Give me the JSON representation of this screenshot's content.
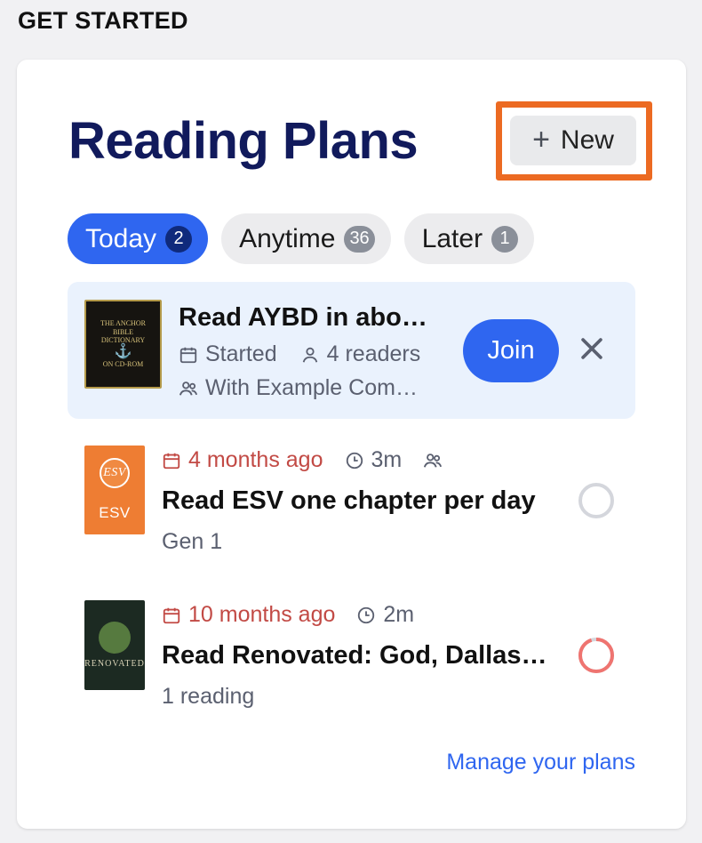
{
  "section_label": "GET STARTED",
  "card": {
    "title": "Reading Plans",
    "new_button": {
      "label": "New",
      "icon": "plus-icon"
    },
    "tabs": [
      {
        "label": "Today",
        "count": "2",
        "active": true
      },
      {
        "label": "Anytime",
        "count": "36",
        "active": false
      },
      {
        "label": "Later",
        "count": "1",
        "active": false
      }
    ],
    "invite": {
      "cover_text": "THE ANCHOR BIBLE DICTIONARY ON CD-ROM",
      "title": "Read AYBD in abo…",
      "status": "Started",
      "readers": "4 readers",
      "community": "With Example Com…",
      "join_label": "Join",
      "icons": [
        "calendar-icon",
        "person-icon",
        "group-icon",
        "close-icon"
      ]
    },
    "plans": [
      {
        "cover_text": "ESV",
        "when": "4 months ago",
        "duration": "3m",
        "title": "Read ESV one chapter per day",
        "subtitle": "Gen 1",
        "progress": 0,
        "icons": [
          "calendar-icon",
          "clock-icon",
          "group-icon"
        ]
      },
      {
        "cover_text": "RENOVATED",
        "when": "10 months ago",
        "duration": "2m",
        "title": "Read Renovated: God, Dallas…",
        "subtitle": "1 reading",
        "progress": 0.95,
        "icons": [
          "calendar-icon",
          "clock-icon"
        ]
      }
    ],
    "manage_link": "Manage your plans"
  },
  "colors": {
    "accent": "#2f66f0",
    "title": "#111a5c",
    "highlight": "#ec6a22",
    "overdue": "#c24a45",
    "invite_bg": "#eaf2fd"
  }
}
